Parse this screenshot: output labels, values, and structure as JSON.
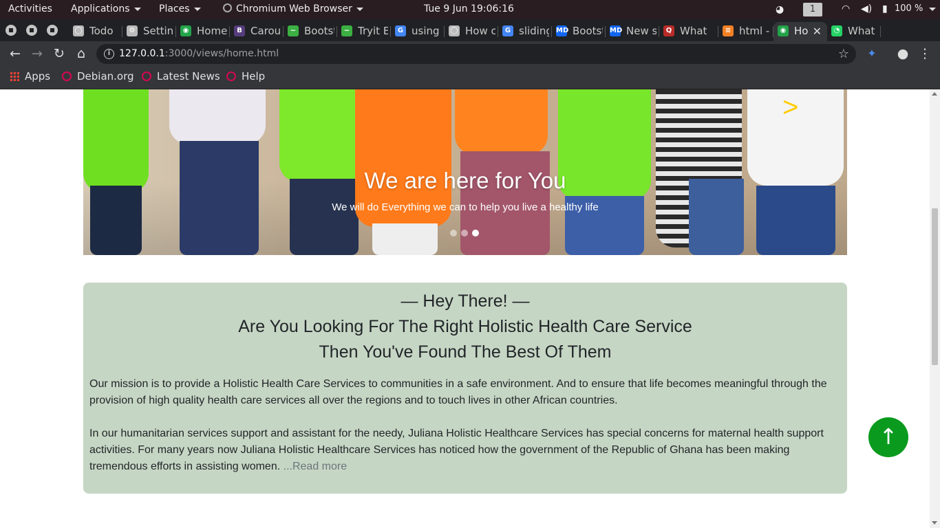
{
  "topbar": {
    "activities": "Activities",
    "applications": "Applications",
    "places": "Places",
    "app_name": "Chromium Web Browser",
    "clock": "Tue 9 Jun  19:06:16",
    "workspace": "1",
    "battery": "100 %"
  },
  "tabs": [
    {
      "title": "Todo",
      "icon": "github-icon"
    },
    {
      "title": "Settings",
      "icon": "settings-gear-icon"
    },
    {
      "title": "Home",
      "icon": "app-icon"
    },
    {
      "title": "Carousel",
      "icon": "bootstrap-icon"
    },
    {
      "title": "Bootstrap",
      "icon": "chart-icon"
    },
    {
      "title": "Tryit Editor",
      "icon": "chart-icon"
    },
    {
      "title": "using",
      "icon": "google-icon"
    },
    {
      "title": "How can",
      "icon": "github-icon"
    },
    {
      "title": "sliding",
      "icon": "google-icon"
    },
    {
      "title": "Bootstrap",
      "icon": "mdb-icon"
    },
    {
      "title": "New s",
      "icon": "mdb-icon"
    },
    {
      "title": "What",
      "icon": "quora-icon"
    },
    {
      "title": "html -",
      "icon": "stackoverflow-icon"
    },
    {
      "title": "Home",
      "icon": "app-icon",
      "active": true
    },
    {
      "title": "What",
      "icon": "whatsapp-icon"
    }
  ],
  "address_bar": {
    "host": "127.0.0.1",
    "path": ":3000/views/home.html"
  },
  "bookmarks": {
    "apps": "Apps",
    "items": [
      "Debian.org",
      "Latest News",
      "Help"
    ]
  },
  "carousel": {
    "title": "We are here for You",
    "subtitle": "We will do Everything we can to help you live a healthy life",
    "next_glyph": ">",
    "slides": 3,
    "active_slide": 3
  },
  "intro": {
    "greeting": "— Hey There! —",
    "headline": "Are You Looking For The Right Holistic Health Care Service",
    "subheadline": "Then You've Found The Best Of Them",
    "paragraph1": "Our mission is to provide a Holistic Health Care Services to communities in a safe environment. And to ensure that life becomes meaningful through the provision of high quality health care services all over the regions and to touch lives in other African countries.",
    "paragraph2": "In our humanitarian services support and assistant for the needy, Juliana Holistic Healthcare Services has special concerns for maternal health support activities. For many years now Juliana Holistic Healthcare Services has noticed how the government of the Republic of Ghana has been making tremendous efforts in assisting women.",
    "read_more": "...Read more"
  },
  "back_to_top": "↑",
  "colors": {
    "intro_bg": "#c6d6c4",
    "back_to_top": "#0a9a1e",
    "chrome_frame": "#202124",
    "toolbar": "#35363a"
  }
}
